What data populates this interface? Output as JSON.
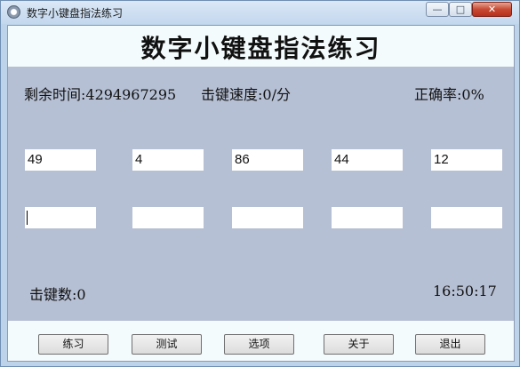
{
  "window": {
    "title": "数字小键盘指法练习",
    "controls": {
      "minimize": "—",
      "maximize": "□",
      "close": "✕"
    }
  },
  "header": {
    "title": "数字小键盘指法练习"
  },
  "stats": {
    "remaining_time": "剩余时间:4294967295",
    "typing_speed": "击键速度:0/分",
    "accuracy": "正确率:0%"
  },
  "targets": [
    "49",
    "4",
    "86",
    "44",
    "12"
  ],
  "answers": [
    "",
    "",
    "",
    "",
    ""
  ],
  "footer": {
    "hits": "击键数:0",
    "clock": "16:50:17"
  },
  "buttons": {
    "practice": "练习",
    "test": "测试",
    "options": "选项",
    "about": "关于",
    "exit": "退出"
  },
  "colors": {
    "client_background": "#b6c0d4",
    "band_background": "#f4fbfc",
    "title_bar": "#c3d7ee",
    "close_button": "#c74a34"
  },
  "icons": [
    "app-icon",
    "minimize-icon",
    "maximize-icon",
    "close-icon"
  ]
}
